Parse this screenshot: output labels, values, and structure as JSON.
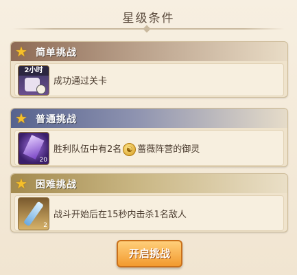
{
  "title": "星级条件",
  "cards": [
    {
      "label": "简单挑战",
      "icon_badge": "2小时",
      "icon_name": "time-potion-icon",
      "desc": "成功通过关卡"
    },
    {
      "label": "普通挑战",
      "icon_name": "purple-crystal-icon",
      "icon_count": "20",
      "desc_before": "胜利队伍中有2名",
      "faction_icon": "faction-coin-icon",
      "coin_glyph": "☯",
      "desc_after": "蔷薇阵营的御灵"
    },
    {
      "label": "困难挑战",
      "icon_name": "blade-shard-icon",
      "icon_count": "2",
      "desc": "战斗开始后在15秒内击杀1名敌人"
    }
  ],
  "button": {
    "label": "开启挑战"
  },
  "colors": {
    "star": "#f6c02a",
    "button": "#f29a2f"
  }
}
